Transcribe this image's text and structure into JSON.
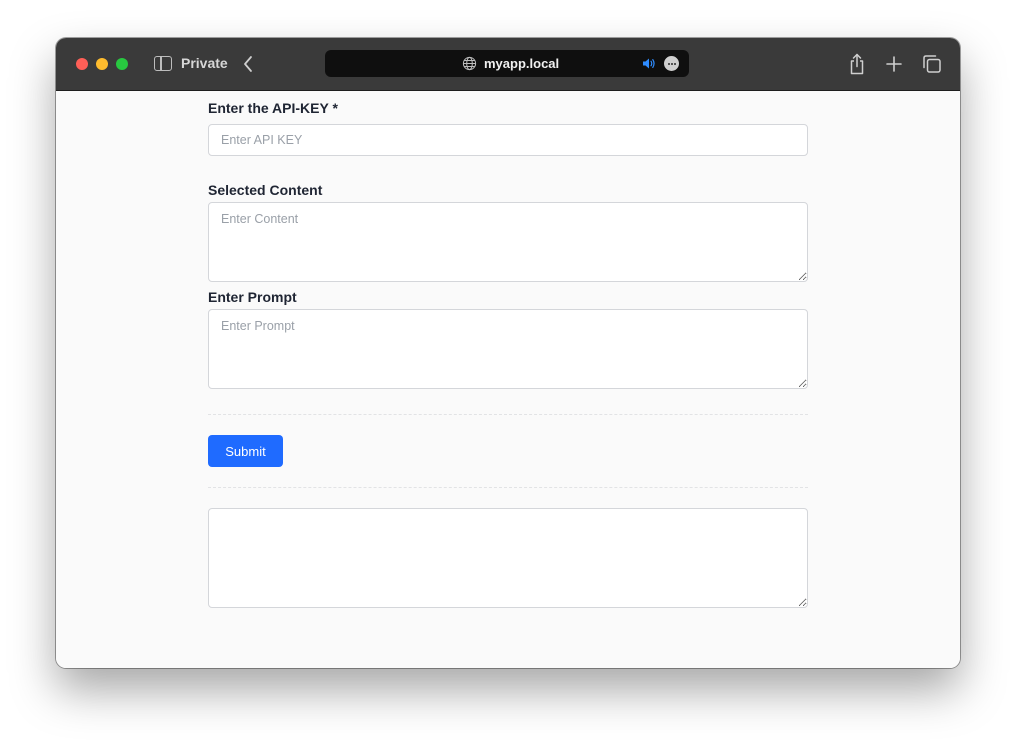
{
  "browser": {
    "private_label": "Private",
    "url": "myapp.local"
  },
  "form": {
    "api_key": {
      "label": "Enter the API-KEY *",
      "placeholder": "Enter API KEY",
      "value": ""
    },
    "content": {
      "label": "Selected Content",
      "placeholder": "Enter Content",
      "value": ""
    },
    "prompt": {
      "label": "Enter Prompt",
      "placeholder": "Enter Prompt",
      "value": ""
    },
    "submit_label": "Submit",
    "output": {
      "value": ""
    }
  },
  "colors": {
    "accent": "#1f6bff",
    "titlebar": "#3a3a3a",
    "background": "#fafafa"
  }
}
